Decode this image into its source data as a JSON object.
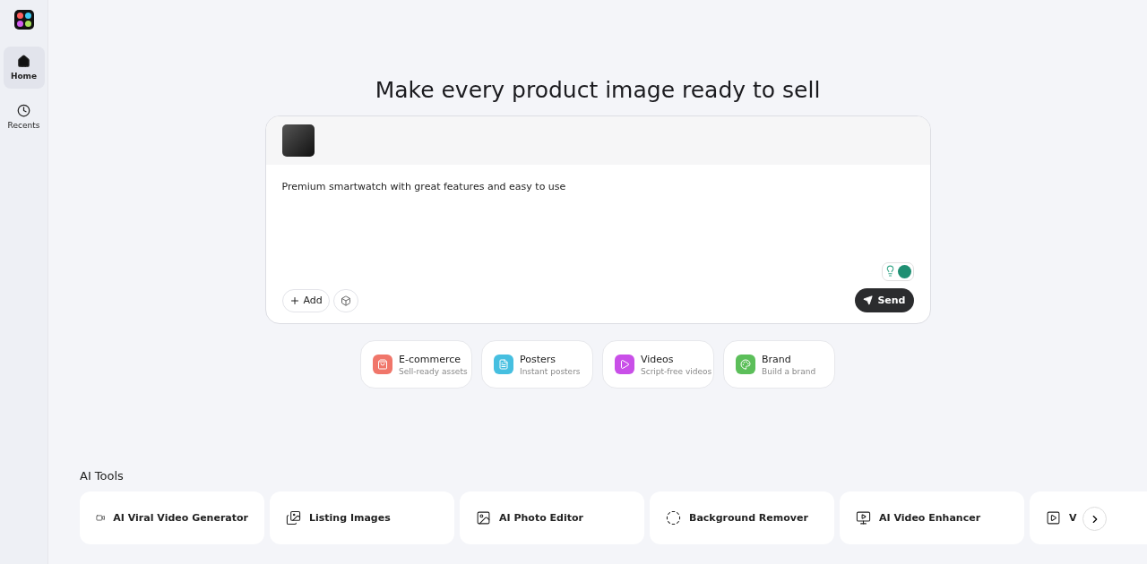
{
  "sidebar": {
    "items": [
      {
        "label": "Home",
        "kind": "home",
        "selected": true
      },
      {
        "label": "Recents",
        "kind": "recents",
        "selected": false
      }
    ]
  },
  "heading": "Make every product image ready to sell",
  "prompt": {
    "value": "Premium smartwatch with great features and easy to use",
    "add_label": "Add",
    "send_label": "Send"
  },
  "categories": [
    {
      "title": "E-commerce",
      "subtitle": "Sell-ready assets",
      "color": "#f0766a",
      "kind": "bag"
    },
    {
      "title": "Posters",
      "subtitle": "Instant posters",
      "color": "#46bfe0",
      "kind": "poster"
    },
    {
      "title": "Videos",
      "subtitle": "Script-free videos",
      "color": "#c94fe8",
      "kind": "play"
    },
    {
      "title": "Brand",
      "subtitle": "Build a brand",
      "color": "#5cbf5a",
      "kind": "brand"
    }
  ],
  "tools_heading": "AI Tools",
  "tools": [
    {
      "label": "AI Viral Video Generator",
      "kind": "camera"
    },
    {
      "label": "Listing Images",
      "kind": "listing"
    },
    {
      "label": "AI Photo Editor",
      "kind": "image"
    },
    {
      "label": "Background Remover",
      "kind": "remover"
    },
    {
      "label": "AI Video Enhancer",
      "kind": "hd"
    },
    {
      "label": "V",
      "kind": "edit"
    }
  ]
}
